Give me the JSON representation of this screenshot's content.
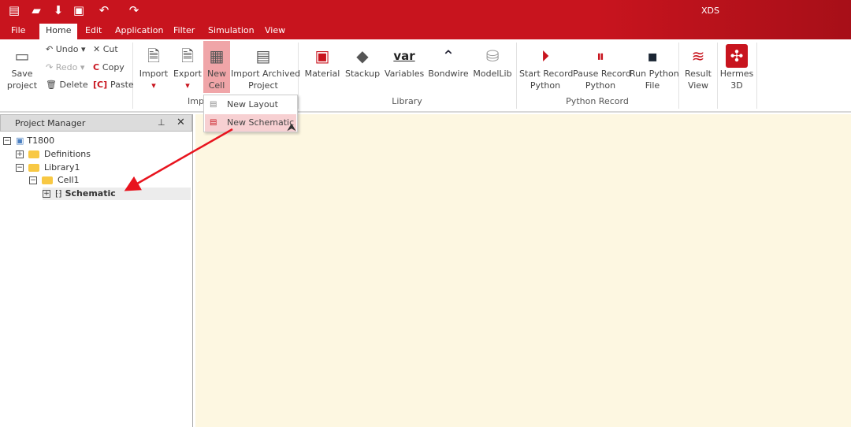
{
  "app": {
    "title": "XDS",
    "accent": "#c8141e"
  },
  "quick_access": [
    "new-file-icon",
    "open-folder-icon",
    "download-icon",
    "save-icon",
    "undo-icon",
    "redo-icon"
  ],
  "tabs": [
    {
      "label": "File"
    },
    {
      "label": "Home",
      "active": true
    },
    {
      "label": "Edit"
    },
    {
      "label": "Application"
    },
    {
      "label": "Filter"
    },
    {
      "label": "Simulation"
    },
    {
      "label": "View"
    }
  ],
  "ribbon": {
    "save": "Save\nproject",
    "undo": "Undo",
    "redo": "Redo",
    "delete": "Delete",
    "cut": "Cut",
    "copy": "Copy",
    "paste": "Paste",
    "import": "Import",
    "export": "Export",
    "new_cell": "New\nCell",
    "import_archived": "Import Archived\nProject",
    "import_group": "Imp",
    "material": "Material",
    "stackup": "Stackup",
    "variables": "Variables",
    "var_glyph": "var",
    "bondwire": "Bondwire",
    "modellib": "ModelLib",
    "library_group": "Library",
    "start_record": "Start Record\nPython",
    "pause_record": "Pause Record\nPython",
    "run_python": "Run Python\nFile",
    "python_group": "Python Record",
    "result_view": "Result\nView",
    "hermes": "Hermes\n3D"
  },
  "menu": {
    "items": [
      "New Layout",
      "New Schematic"
    ],
    "highlighted": "New Schematic"
  },
  "panel": {
    "title": "Project Manager",
    "tree": [
      {
        "label": "T1800"
      },
      {
        "label": "Definitions"
      },
      {
        "label": "Library1"
      },
      {
        "label": "Cell1"
      },
      {
        "label": "Schematic",
        "selected": true
      }
    ]
  }
}
